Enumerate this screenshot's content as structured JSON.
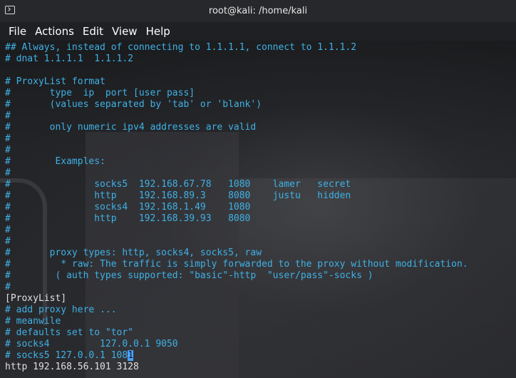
{
  "window": {
    "title": "root@kali: /home/kali",
    "icon": "terminal-icon"
  },
  "menu": [
    "File",
    "Actions",
    "Edit",
    "View",
    "Help"
  ],
  "lines": [
    {
      "text": "## Always, instead of connecting to 1.1.1.1, connect to 1.1.1.2",
      "type": "comment"
    },
    {
      "text": "# dnat 1.1.1.1  1.1.1.2",
      "type": "comment"
    },
    {
      "text": "",
      "type": "comment"
    },
    {
      "text": "# ProxyList format",
      "type": "comment"
    },
    {
      "text": "#       type  ip  port [user pass]",
      "type": "comment"
    },
    {
      "text": "#       (values separated by 'tab' or 'blank')",
      "type": "comment"
    },
    {
      "text": "#",
      "type": "comment"
    },
    {
      "text": "#       only numeric ipv4 addresses are valid",
      "type": "comment"
    },
    {
      "text": "#",
      "type": "comment"
    },
    {
      "text": "#",
      "type": "comment"
    },
    {
      "text": "#        Examples:",
      "type": "comment"
    },
    {
      "text": "#",
      "type": "comment"
    },
    {
      "text": "#               socks5  192.168.67.78   1080    lamer   secret",
      "type": "comment"
    },
    {
      "text": "#               http    192.168.89.3    8080    justu   hidden",
      "type": "comment"
    },
    {
      "text": "#               socks4  192.168.1.49    1080",
      "type": "comment"
    },
    {
      "text": "#               http    192.168.39.93   8080",
      "type": "comment"
    },
    {
      "text": "#",
      "type": "comment"
    },
    {
      "text": "#",
      "type": "comment"
    },
    {
      "text": "#       proxy types: http, socks4, socks5, raw",
      "type": "comment"
    },
    {
      "text": "#         * raw: The traffic is simply forwarded to the proxy without modification.",
      "type": "comment"
    },
    {
      "text": "#        ( auth types supported: \"basic\"-http  \"user/pass\"-socks )",
      "type": "comment"
    },
    {
      "text": "#",
      "type": "comment"
    },
    {
      "text": "[ProxyList]",
      "type": "plain"
    },
    {
      "text": "# add proxy here ...",
      "type": "comment"
    },
    {
      "text": "# meanwile",
      "type": "comment"
    },
    {
      "text": "# defaults set to \"tor\"",
      "type": "comment"
    },
    {
      "text": "# socks4         127.0.0.1 9050",
      "type": "comment"
    },
    {
      "text": "# socks5 127.0.0.1 108",
      "type": "comment",
      "cursor_char": "1"
    },
    {
      "text": "http 192.168.56.101 3128",
      "type": "plain"
    }
  ],
  "colors": {
    "comment": "#3fb1e6",
    "plain": "#e0e0e0",
    "cursor": "#4aa3ff"
  }
}
